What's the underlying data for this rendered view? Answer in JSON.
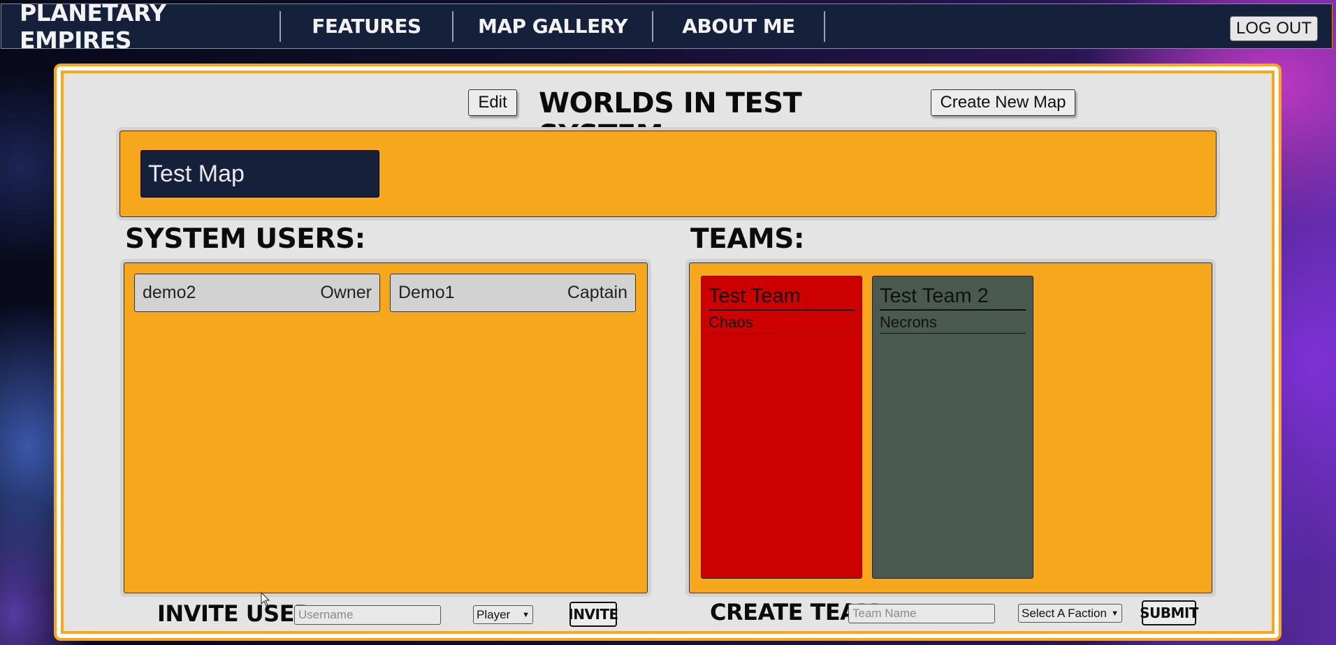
{
  "nav": {
    "brand": "PLANETARY EMPIRES",
    "links": [
      "FEATURES",
      "MAP GALLERY",
      "ABOUT ME"
    ],
    "logout": "LOG OUT"
  },
  "system": {
    "title": "WORLDS IN TEST SYSTEM:",
    "edit_label": "Edit",
    "create_map_label": "Create New Map",
    "maps": [
      "Test Map"
    ]
  },
  "users": {
    "title": "SYSTEM USERS:",
    "list": [
      {
        "name": "demo2",
        "role": "Owner"
      },
      {
        "name": "Demo1",
        "role": "Captain"
      }
    ],
    "invite_label": "INVITE USER:",
    "username_placeholder": "Username",
    "role_selected": "Player",
    "invite_button": "INVITE"
  },
  "teams": {
    "title": "TEAMS:",
    "list": [
      {
        "name": "Test Team",
        "faction": "Chaos",
        "color": "#cc0000"
      },
      {
        "name": "Test Team 2",
        "faction": "Necrons",
        "color": "#4a5a50"
      }
    ],
    "create_label": "CREATE TEAM:",
    "teamname_placeholder": "Team Name",
    "faction_selected": "Select A Faction",
    "submit_button": "SUBMIT"
  },
  "colors": {
    "accent": "#f7a71c",
    "navbar": "#15203b",
    "panel": "#e4e4e4"
  }
}
